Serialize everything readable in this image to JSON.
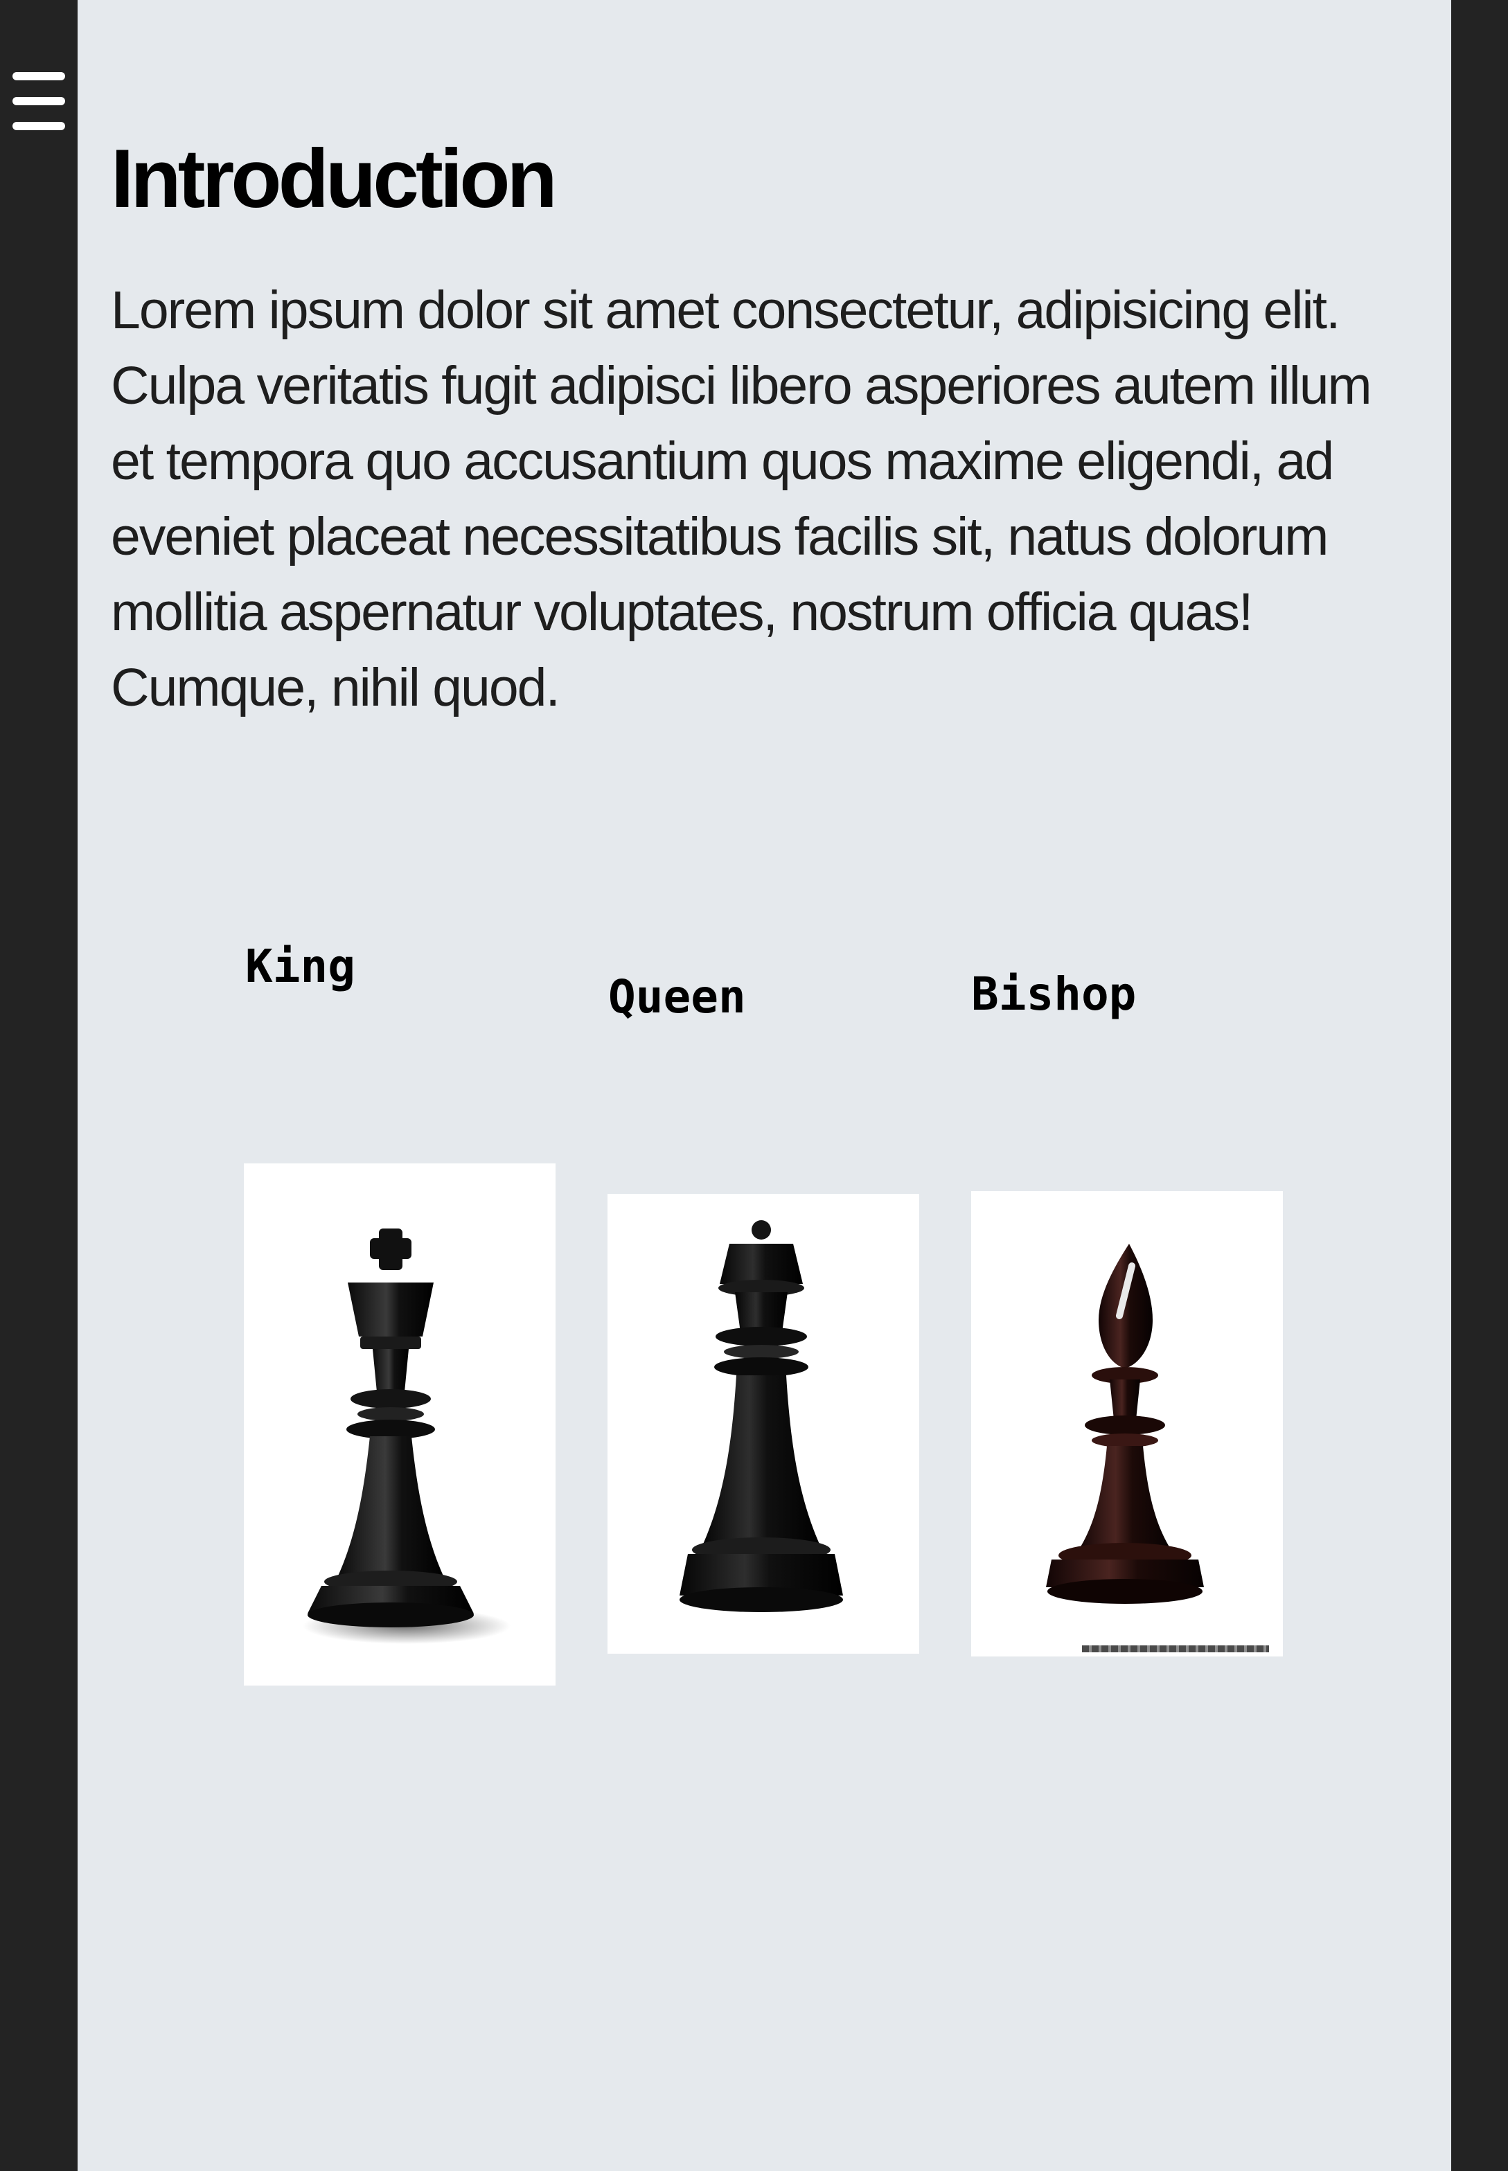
{
  "nav": {
    "menu_icon": "hamburger-menu-icon"
  },
  "intro": {
    "title": "Introduction",
    "body": "Lorem ipsum dolor sit amet consectetur, adipisicing elit. Culpa veritatis fugit adipisci libero asperiores autem illum et tempora quo accusantium quos maxime eligendi, ad eveniet placeat necessitatibus facilis sit, natus dolorum mollitia aspernatur voluptates, nostrum officia quas! Cumque, nihil quod."
  },
  "pieces": [
    {
      "label": "King",
      "image": "black-king-chess-piece"
    },
    {
      "label": "Queen",
      "image": "black-queen-chess-piece"
    },
    {
      "label": "Bishop",
      "image": "dark-brown-bishop-chess-piece"
    }
  ],
  "colors": {
    "page_background": "#e5e9ed",
    "sidebar": "#232323",
    "heading_text": "#000000"
  }
}
